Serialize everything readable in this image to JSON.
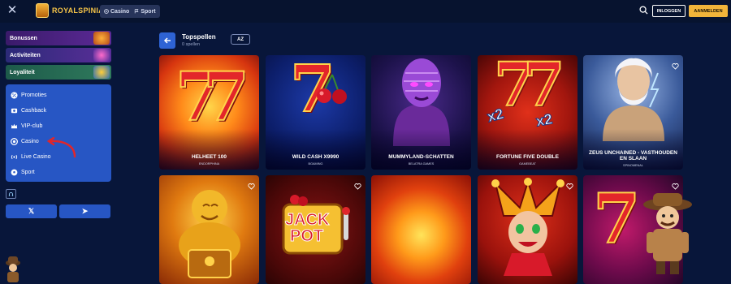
{
  "header": {
    "logo_text": "ROYALSPINIA",
    "nav": {
      "casino": "Casino",
      "sport": "Sport"
    },
    "login_label": "INLOGGEN",
    "register_label": "AANMELDEN"
  },
  "sidebar": {
    "promo_cards": [
      {
        "label": "Bonussen"
      },
      {
        "label": "Activiteiten"
      },
      {
        "label": "Loyaliteit"
      }
    ],
    "menu": [
      {
        "label": "Promoties",
        "icon": "percent-icon"
      },
      {
        "label": "Cashback",
        "icon": "cashback-icon"
      },
      {
        "label": "VIP-club",
        "icon": "crown-icon"
      },
      {
        "label": "Casino",
        "icon": "casino-chip-icon"
      },
      {
        "label": "Live Casino",
        "icon": "live-icon"
      },
      {
        "label": "Sport",
        "icon": "soccer-ball-icon"
      }
    ],
    "socials": {
      "x": "𝕏",
      "telegram": "➤"
    }
  },
  "main": {
    "title": "Topspellen",
    "subtitle": "0 spellen",
    "sort_label": "AZ",
    "games_row1": [
      {
        "name": "HELHEET 100",
        "provider": "ENDORPHINA"
      },
      {
        "name": "WILD CASH X9990",
        "provider": "BGAMING"
      },
      {
        "name": "MUMMYLAND-SCHATTEN",
        "provider": "BELATRA GAMES"
      },
      {
        "name": "FORTUNE FIVE DOUBLE",
        "provider": "GAMEBEAT"
      },
      {
        "name": "ZEUS UNCHAINED - VASTHOUDEN EN SLAAN",
        "provider": "SPINOMENAL"
      }
    ],
    "games_row2": [
      {
        "name": "",
        "provider": ""
      },
      {
        "name": "",
        "provider": ""
      },
      {
        "name": "",
        "provider": ""
      },
      {
        "name": "",
        "provider": ""
      },
      {
        "name": "",
        "provider": ""
      }
    ],
    "jackpot_art_text": [
      "JACK",
      "POT"
    ],
    "multiplier_text": "x2"
  }
}
